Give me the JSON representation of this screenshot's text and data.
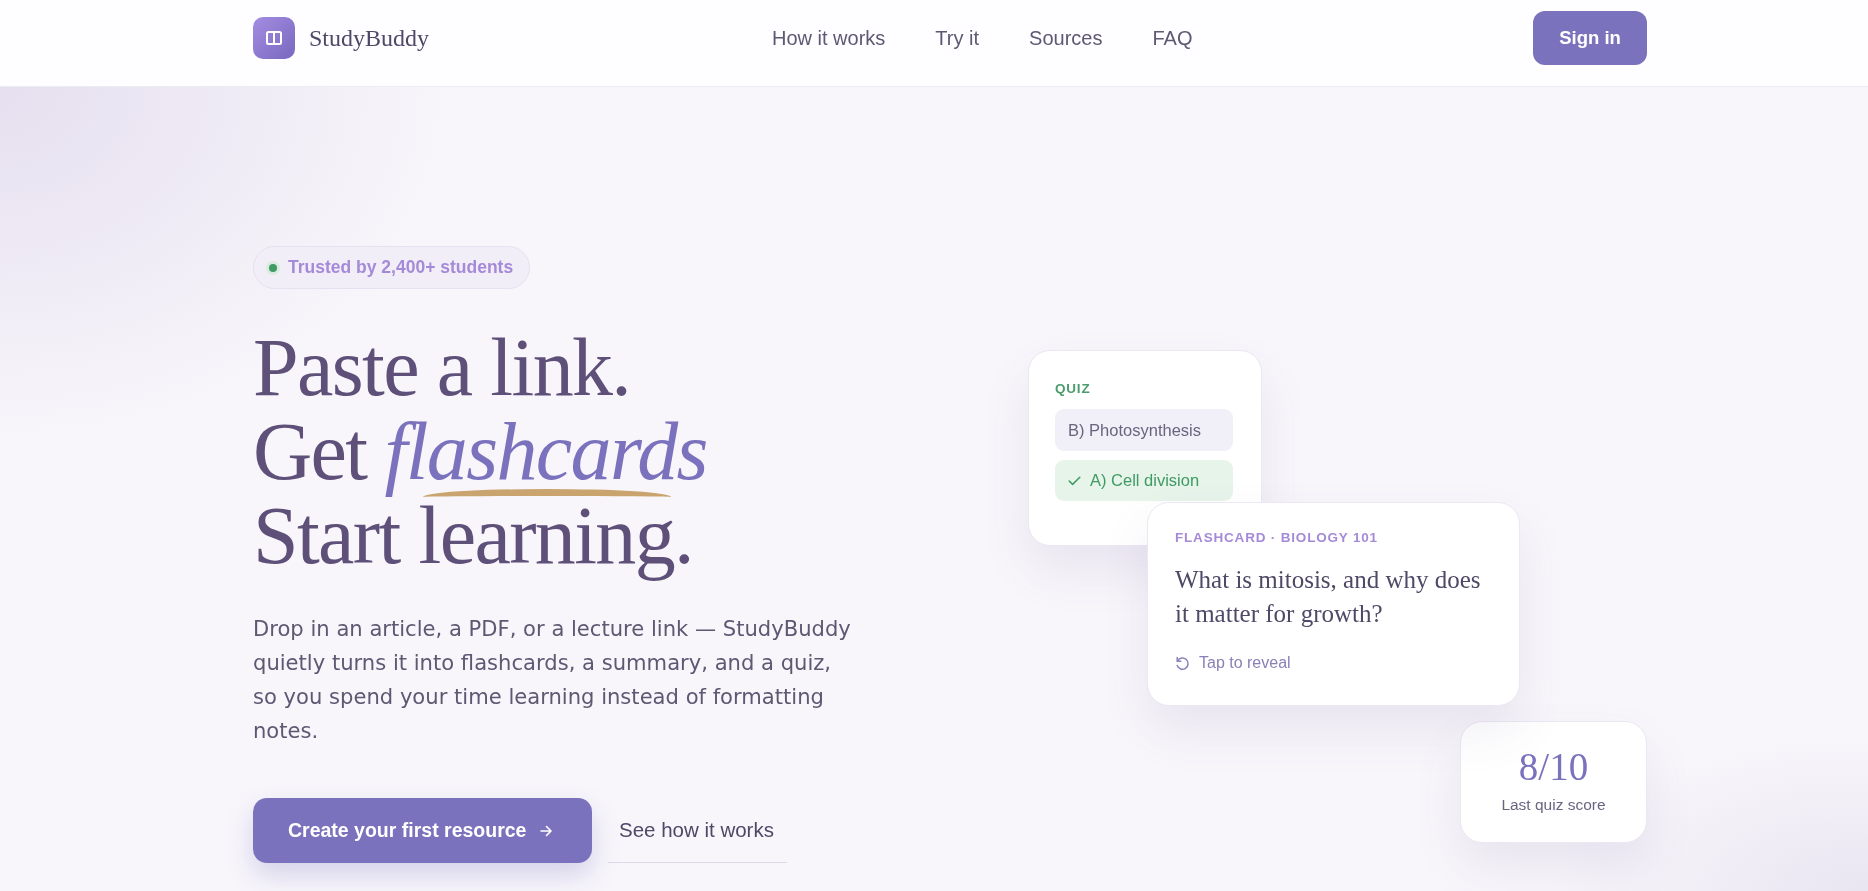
{
  "header": {
    "brand": "StudyBuddy",
    "nav": [
      "How it works",
      "Try it",
      "Sources",
      "FAQ"
    ],
    "sign_in": "Sign in"
  },
  "hero": {
    "badge": "Trusted by 2,400+ students",
    "headline": [
      {
        "text": "Paste a link."
      },
      {
        "text": "Get",
        "highlight": "flashcards"
      },
      {
        "text": "Start learning."
      }
    ],
    "description": "Drop in an article, a PDF, or a lecture link — StudyBuddy quietly turns it into flashcards, a summary, and a quiz, so you spend your time learning instead of formatting notes.",
    "primary_button": "Create your first resource",
    "secondary_link": "See how it works"
  },
  "preview": {
    "quiz": {
      "label": "QUIZ",
      "options": [
        {
          "text": "B) Photosynthesis",
          "correct": false
        },
        {
          "text": "A) Cell division",
          "correct": true
        }
      ]
    },
    "flashcard": {
      "label": "FLASHCARD · BIOLOGY 101",
      "question": "What is mitosis, and why does it matter for growth?",
      "hint": "Tap to reveal"
    },
    "score": {
      "value": "8/10",
      "label": "Last quiz score"
    }
  }
}
